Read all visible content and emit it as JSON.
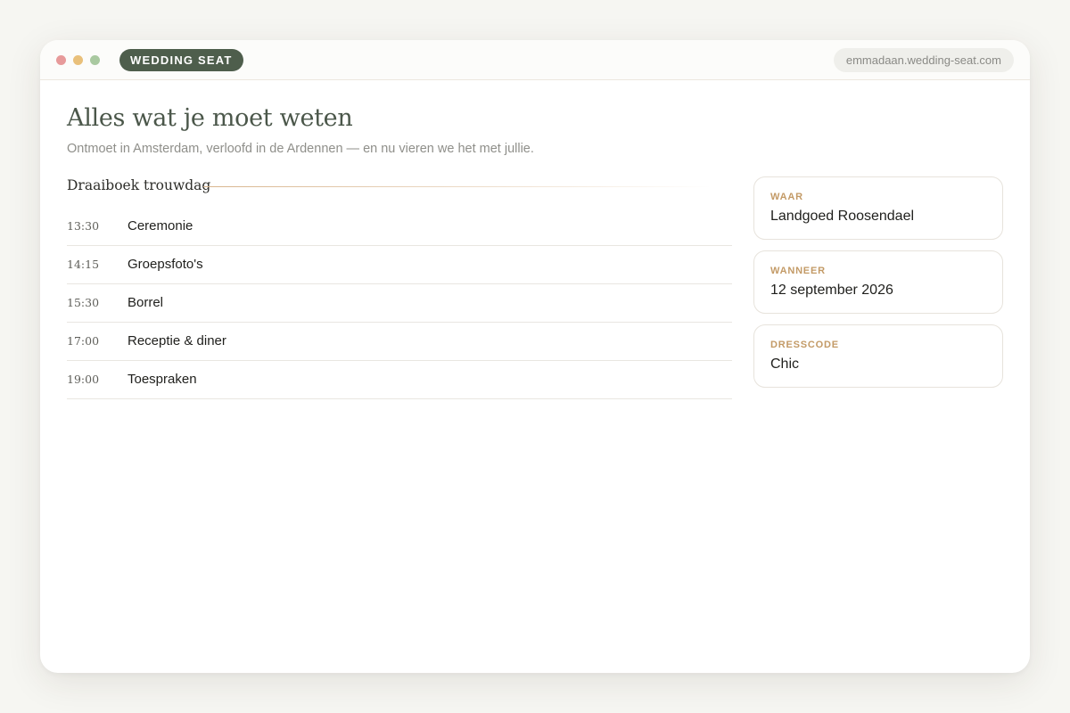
{
  "window": {
    "controls": [
      "close",
      "minimize",
      "maximize"
    ],
    "brand": "WEDDING SEAT",
    "url": "emmadaan.wedding-seat.com"
  },
  "page": {
    "title": "Alles wat je moet weten",
    "subtitle": "Ontmoet in Amsterdam, verloofd in de Ardennen — en nu vieren we het met jullie."
  },
  "schedule": {
    "heading": "Draaiboek trouwdag",
    "items": [
      {
        "time": "13:30",
        "event": "Ceremonie"
      },
      {
        "time": "14:15",
        "event": "Groepsfoto's"
      },
      {
        "time": "15:30",
        "event": "Borrel"
      },
      {
        "time": "17:00",
        "event": "Receptie & diner"
      },
      {
        "time": "19:00",
        "event": "Toespraken"
      }
    ]
  },
  "info": {
    "where": {
      "label": "WAAR",
      "value": "Landgoed Roosendael"
    },
    "when": {
      "label": "WANNEER",
      "value": "12 september 2026"
    },
    "dresscode": {
      "label": "DRESSCODE",
      "value": "Chic"
    }
  },
  "colors": {
    "brand": "#4e5e4c",
    "accent": "#c39a66",
    "title": "#4b574a",
    "background": "#f6f6f2"
  }
}
